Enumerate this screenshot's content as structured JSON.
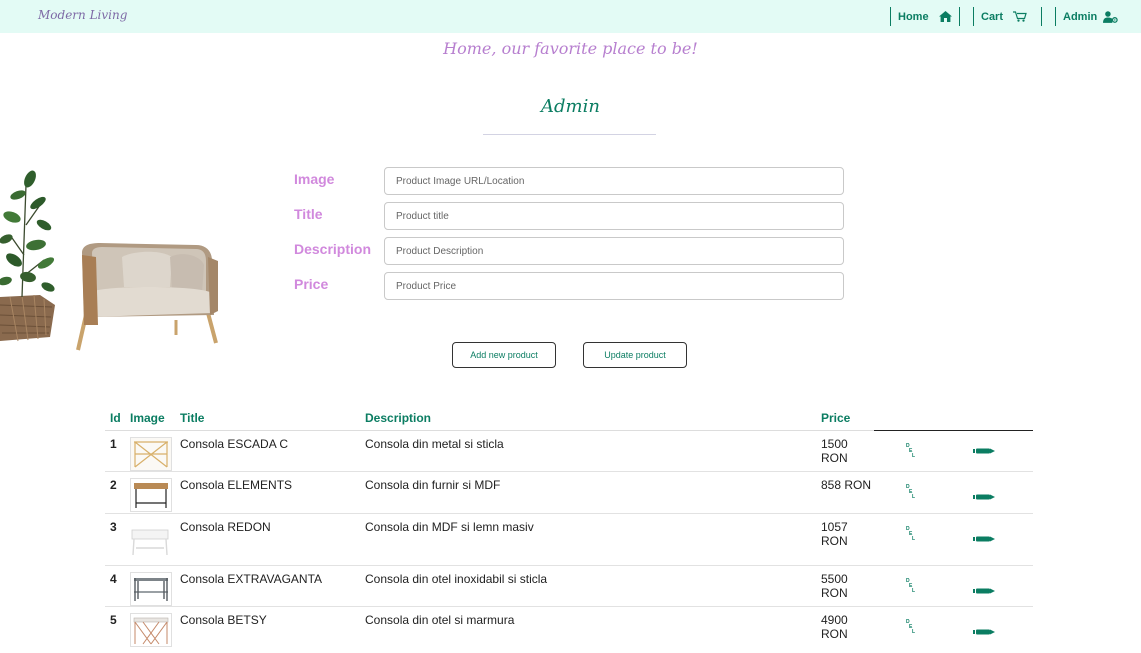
{
  "brand": "Modern Living",
  "nav": {
    "home_label": "Home",
    "cart_label": "Cart",
    "admin_label": "Admin"
  },
  "tagline": "Home, our favorite place to be!",
  "page_title": "Admin",
  "form": {
    "image_label": "Image",
    "image_placeholder": "Product Image URL/Location",
    "title_label": "Title",
    "title_placeholder": "Product title",
    "description_label": "Description",
    "description_placeholder": "Product Description",
    "price_label": "Price",
    "price_placeholder": "Product Price"
  },
  "buttons": {
    "add": "Add new product",
    "update": "Update product"
  },
  "table": {
    "headers": {
      "id": "Id",
      "image": "Image",
      "title": "Title",
      "description": "Description",
      "price": "Price"
    },
    "rows": [
      {
        "id": "1",
        "title": "Consola ESCADA C",
        "description": "Consola din metal si sticla",
        "price": "1500 RON",
        "thumb": "gold-x-console"
      },
      {
        "id": "2",
        "title": "Consola ELEMENTS",
        "description": "Consola din furnir si MDF",
        "price": "858 RON",
        "thumb": "wood-black-console"
      },
      {
        "id": "3",
        "title": "Consola REDON",
        "description": "Consola din MDF si lemn masiv",
        "price": "1057 RON",
        "thumb": "white-console"
      },
      {
        "id": "4",
        "title": "Consola EXTRAVAGANTA",
        "description": "Consola din otel inoxidabil si sticla",
        "price": "5500 RON",
        "thumb": "steel-glass-console"
      },
      {
        "id": "5",
        "title": "Consola BETSY",
        "description": "Consola din otel si marmura",
        "price": "4900 RON",
        "thumb": "copper-marble-console"
      }
    ],
    "delete_icon_letters": [
      "D",
      "E",
      "L"
    ]
  },
  "colors": {
    "accent": "#0b7d62",
    "topbar_bg": "#e3fbf5",
    "label_pink": "#d189dd",
    "tagline_purple": "#b77fcf"
  },
  "icons": {
    "home": "home-icon",
    "cart": "cart-icon",
    "admin": "user-cog-icon",
    "delete": "delete-icon",
    "edit": "pencil-icon"
  }
}
